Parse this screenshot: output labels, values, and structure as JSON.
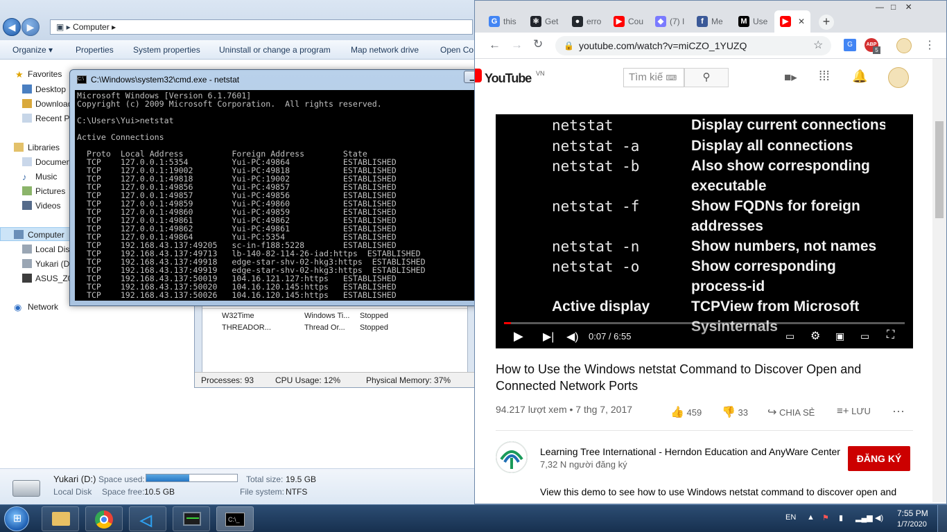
{
  "explorer": {
    "address": "Computer",
    "toolbar": [
      "Organize ▾",
      "Properties",
      "System properties",
      "Uninstall or change a program",
      "Map network drive",
      "Open Co"
    ],
    "nav": {
      "favorites": "Favorites",
      "desktop": "Desktop",
      "downloads": "Download",
      "recent": "Recent Pl",
      "libraries": "Libraries",
      "documents": "Documen",
      "music": "Music",
      "pictures": "Pictures",
      "videos": "Videos",
      "computer": "Computer",
      "local_disk": "Local Disk",
      "yukari": "Yukari (D:",
      "asus": "ASUS_Z00",
      "network": "Network"
    },
    "details": {
      "name": "Yukari (D:)",
      "type": "Local Disk",
      "space_used_label": "Space used:",
      "space_used_fraction": 0.47,
      "space_free_label": "Space free:",
      "space_free": "10.5 GB",
      "total_size_label": "Total size:",
      "total_size": "19.5 GB",
      "fs_label": "File system:",
      "fs": "NTFS"
    }
  },
  "taskmgr": {
    "rows": [
      {
        "name": "W32Time",
        "desc": "Windows Ti...",
        "status": "Stopped"
      },
      {
        "name": "THREADOR...",
        "desc": "Thread Or...",
        "status": "Stopped"
      }
    ],
    "processes": "Processes: 93",
    "cpu": "CPU Usage: 12%",
    "memory": "Physical Memory: 37%"
  },
  "cmd": {
    "title": "C:\\Windows\\system32\\cmd.exe - netstat",
    "lines": [
      "Microsoft Windows [Version 6.1.7601]",
      "Copyright (c) 2009 Microsoft Corporation.  All rights reserved.",
      "",
      "C:\\Users\\Yui>netstat",
      "",
      "Active Connections",
      "",
      "  Proto  Local Address          Foreign Address        State",
      "  TCP    127.0.0.1:5354         Yui-PC:49864           ESTABLISHED",
      "  TCP    127.0.0.1:19002        Yui-PC:49818           ESTABLISHED",
      "  TCP    127.0.0.1:49818        Yui-PC:19002           ESTABLISHED",
      "  TCP    127.0.0.1:49856        Yui-PC:49857           ESTABLISHED",
      "  TCP    127.0.0.1:49857        Yui-PC:49856           ESTABLISHED",
      "  TCP    127.0.0.1:49859        Yui-PC:49860           ESTABLISHED",
      "  TCP    127.0.0.1:49860        Yui-PC:49859           ESTABLISHED",
      "  TCP    127.0.0.1:49861        Yui-PC:49862           ESTABLISHED",
      "  TCP    127.0.0.1:49862        Yui-PC:49861           ESTABLISHED",
      "  TCP    127.0.0.1:49864        Yui-PC:5354            ESTABLISHED",
      "  TCP    192.168.43.137:49205   sc-in-f188:5228        ESTABLISHED",
      "  TCP    192.168.43.137:49713   lb-140-82-114-26-iad:https  ESTABLISHED",
      "  TCP    192.168.43.137:49918   edge-star-shv-02-hkg3:https  ESTABLISHED",
      "  TCP    192.168.43.137:49919   edge-star-shv-02-hkg3:https  ESTABLISHED",
      "  TCP    192.168.43.137:50019   104.16.121.127:https   ESTABLISHED",
      "  TCP    192.168.43.137:50020   104.16.120.145:https   ESTABLISHED",
      "  TCP    192.168.43.137:50026   104.16.120.145:https   ESTABLISHED"
    ]
  },
  "chrome": {
    "tabs": [
      {
        "label": "this",
        "icon": "G",
        "color": "#4285f4"
      },
      {
        "label": "Get",
        "icon": "⚛",
        "color": "#20232a"
      },
      {
        "label": "erro",
        "icon": "●",
        "color": "#24292e"
      },
      {
        "label": "Cou",
        "icon": "▶",
        "color": "#ff0000"
      },
      {
        "label": "(7) I",
        "icon": "◆",
        "color": "#7a7aff"
      },
      {
        "label": "Me",
        "icon": "f",
        "color": "#3b5998"
      },
      {
        "label": "Use",
        "icon": "M",
        "color": "#000000"
      },
      {
        "label": "",
        "icon": "▶",
        "color": "#ff0000"
      }
    ],
    "url": "youtube.com/watch?v=miCZO_1YUZQ",
    "badge": "5"
  },
  "youtube": {
    "logo": "YouTube",
    "region": "VN",
    "search_placeholder": "Tìm kiế",
    "slide": {
      "commands": [
        "netstat",
        "netstat -a",
        "netstat -b",
        "",
        "netstat -f",
        "",
        "netstat -n",
        "netstat -o",
        "",
        "Active display",
        ""
      ],
      "descriptions": [
        "Display current connections",
        "Display all connections",
        "Also show corresponding",
        "executable",
        "Show FQDNs for foreign",
        "addresses",
        "Show numbers, not names",
        "Show corresponding",
        "process-id",
        "TCPView from Microsoft",
        "Sysinternals"
      ]
    },
    "time": "0:07 / 6:55",
    "progress_fraction": 0.018,
    "title": "How to Use the Windows netstat Command to Discover Open and Connected Network Ports",
    "views": "94.217 lượt xem • 7 thg 7, 2017",
    "likes": "459",
    "dislikes": "33",
    "share": "CHIA SẺ",
    "save": "LƯU",
    "channel": "Learning Tree International - Herndon Education and AnyWare Center",
    "subscribers": "7,32 N người đăng ký",
    "subscribe": "ĐĂNG KÝ",
    "description": "View this demo to see how to use Windows netstat command to discover open and"
  },
  "taskbar": {
    "lang": "EN",
    "time": "7:55 PM",
    "date": "1/7/2020"
  }
}
